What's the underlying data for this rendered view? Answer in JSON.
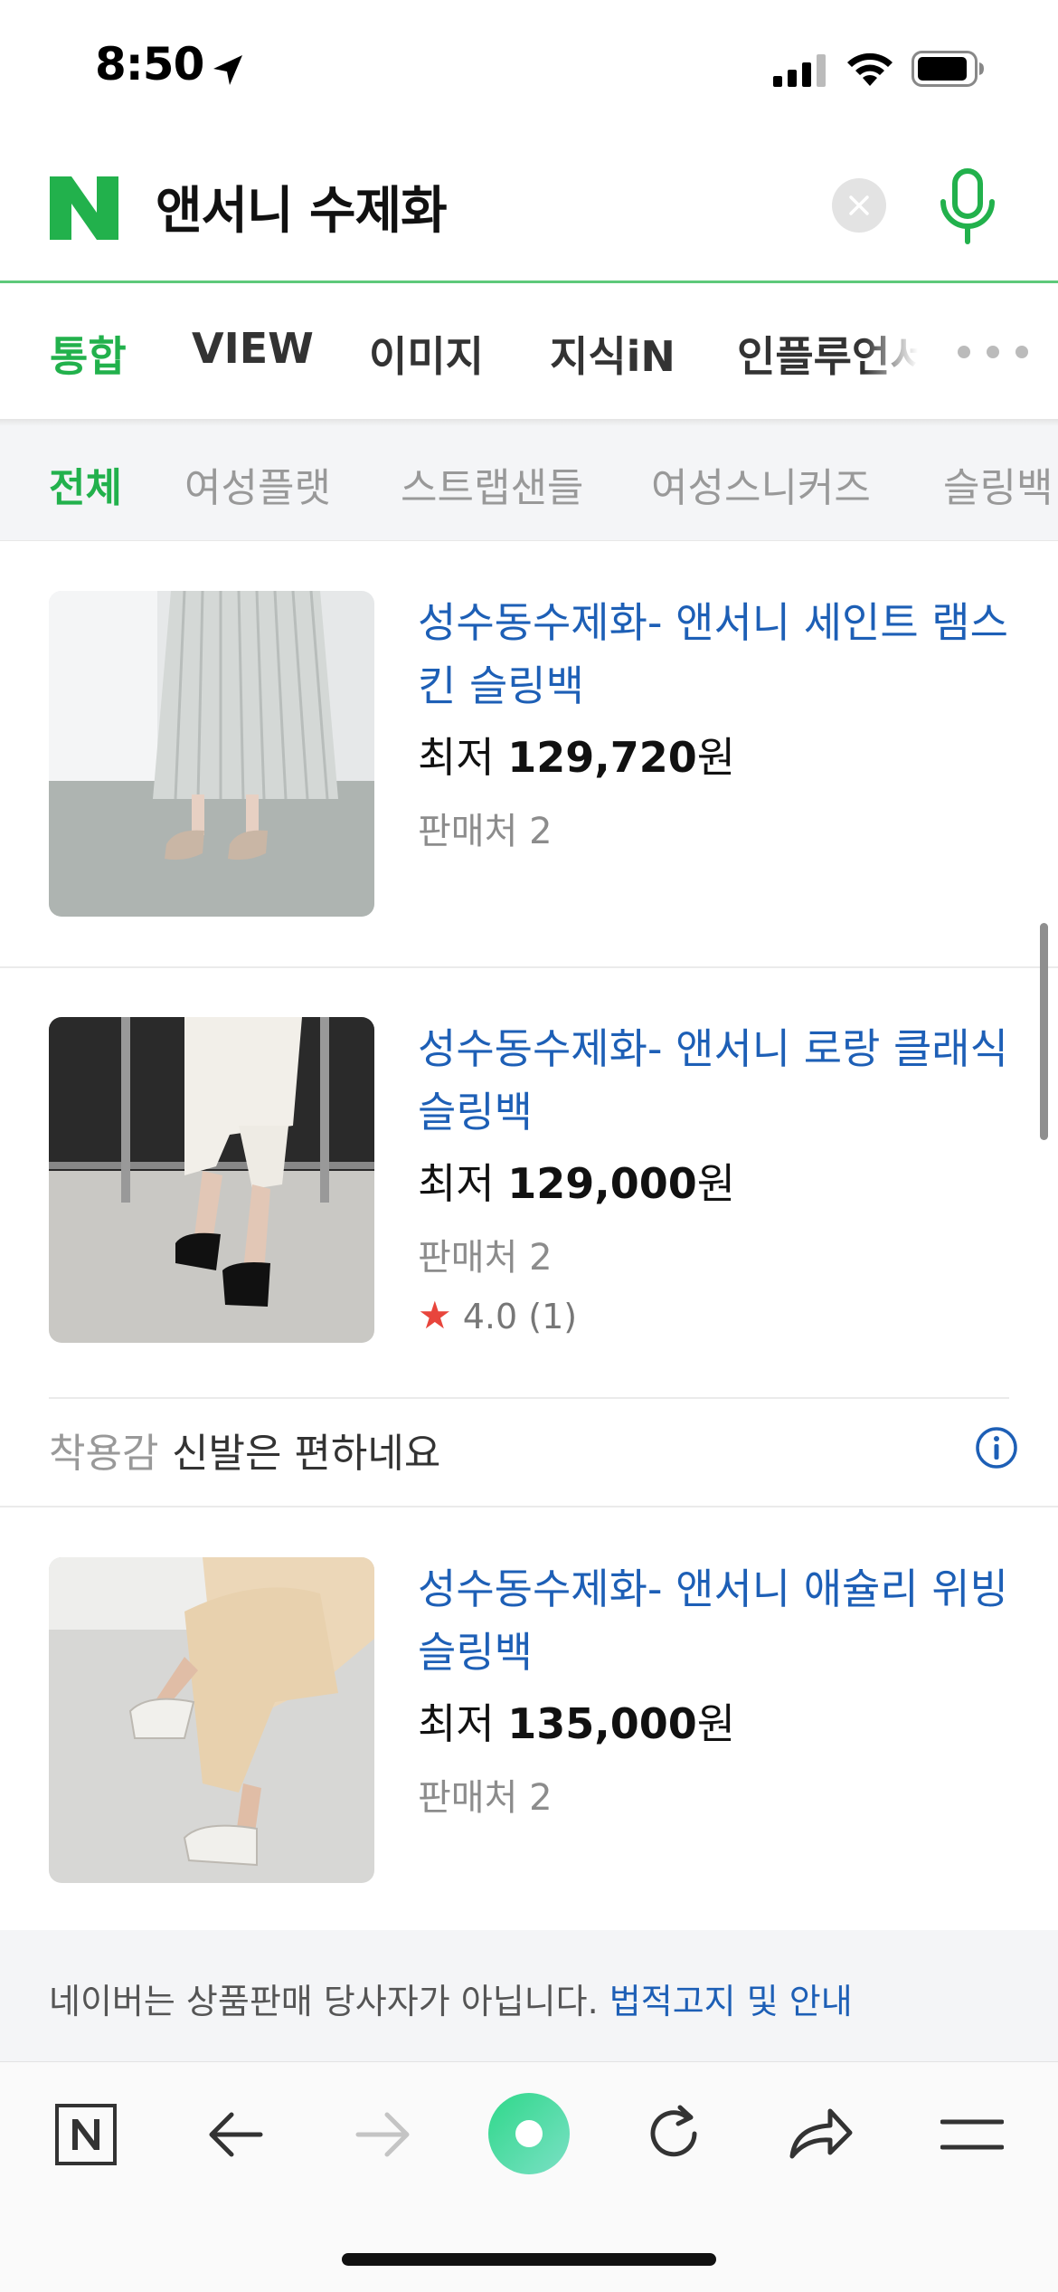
{
  "status_bar": {
    "time": "8:50"
  },
  "search": {
    "query": "앤서니 수제화",
    "logo_letter": "N"
  },
  "tabs": [
    {
      "label": "통합",
      "active": true
    },
    {
      "label": "VIEW",
      "active": false
    },
    {
      "label": "이미지",
      "active": false
    },
    {
      "label": "지식iN",
      "active": false
    },
    {
      "label": "인플루언서",
      "active": false
    }
  ],
  "categories": [
    {
      "label": "전체",
      "active": true
    },
    {
      "label": "여성플랫",
      "active": false
    },
    {
      "label": "스트랩샌들",
      "active": false
    },
    {
      "label": "여성스니커즈",
      "active": false
    },
    {
      "label": "슬링백",
      "active": false
    }
  ],
  "products": [
    {
      "title": "성수동수제화- 앤서니 세인트 램스킨 슬링백",
      "price_prefix": "최저",
      "price": "129,720",
      "price_unit": "원",
      "sellers": "판매처 2"
    },
    {
      "title": "성수동수제화- 앤서니 로랑 클래식 슬링백",
      "price_prefix": "최저",
      "price": "129,000",
      "price_unit": "원",
      "sellers": "판매처 2",
      "rating": "4.0",
      "rating_count": "(1)",
      "review_label": "착용감",
      "review_text": "신발은 편하네요"
    },
    {
      "title": "성수동수제화- 앤서니 애슐리 위빙 슬링백",
      "price_prefix": "최저",
      "price": "135,000",
      "price_unit": "원",
      "sellers": "판매처 2"
    }
  ],
  "footer": {
    "note": "네이버는 상품판매 당사자가 아닙니다.",
    "link": "법적고지 및 안내"
  },
  "colors": {
    "brand_green": "#22b14c",
    "link_blue": "#1d5fb6",
    "star_red": "#e8453c"
  },
  "icons": [
    "location-arrow-icon",
    "signal-icon",
    "wifi-icon",
    "battery-icon",
    "clear-icon",
    "mic-icon",
    "more-icon",
    "info-icon",
    "naver-home-icon",
    "back-icon",
    "forward-icon",
    "green-dot-icon",
    "reload-icon",
    "share-icon",
    "menu-icon"
  ]
}
